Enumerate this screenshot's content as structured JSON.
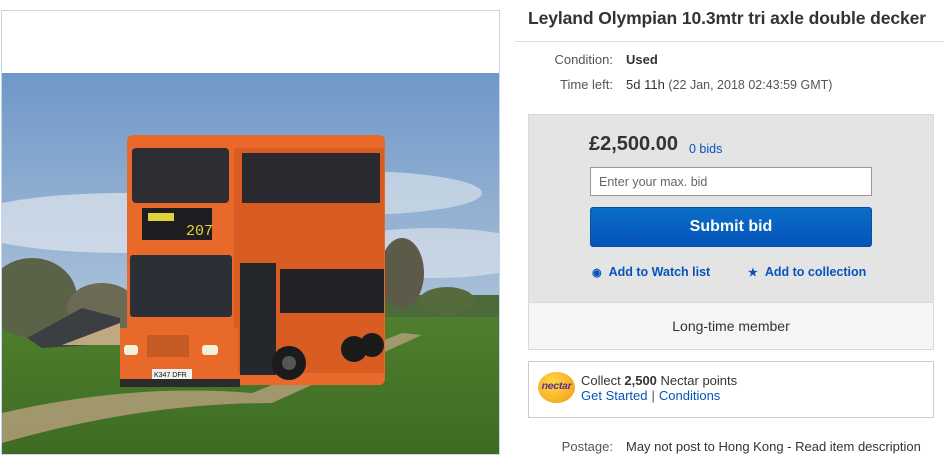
{
  "listing": {
    "title": "Leyland Olympian 10.3mtr tri axle double decker",
    "photo_alt": "Orange double-decker bus in a field"
  },
  "details": {
    "condition_label": "Condition:",
    "condition_value": "Used",
    "time_label": "Time left:",
    "time_value": "5d 11h",
    "time_detail": "(22 Jan, 2018  02:43:59 GMT)"
  },
  "bidding": {
    "price": "£2,500.00",
    "bids": "0 bids",
    "input_placeholder": "Enter your max. bid",
    "submit_label": "Submit bid",
    "watch_label": "Add to Watch list",
    "collection_label": "Add to collection",
    "member_text": "Long-time member"
  },
  "nectar": {
    "logo_text": "nectar",
    "collect_prefix": "Collect",
    "points": "2,500",
    "collect_suffix": "Nectar points",
    "get_started": "Get Started",
    "separator": "|",
    "conditions": "Conditions"
  },
  "postage": {
    "label": "Postage:",
    "value": "May not post to Hong Kong - Read item description"
  },
  "bus_display": {
    "route_number": "207",
    "plate": "K347 DFR"
  },
  "colors": {
    "link": "#0654ba",
    "button": "#0654ba",
    "bus_orange": "#e8692a"
  }
}
